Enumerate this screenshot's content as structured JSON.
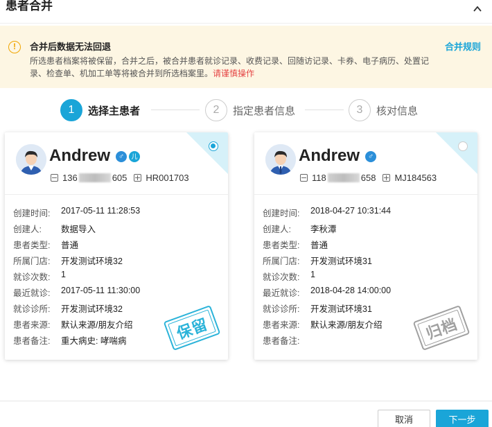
{
  "header": {
    "title": "患者合并"
  },
  "warning": {
    "title": "合并后数据无法回退",
    "text": "所选患者档案将被保留，合并之后，被合并患者就诊记录、收费记录、回随访记录、卡券、电子病历、处置记录、检查单、机加工单等将被合并到所选档案里。",
    "caution": "请谨慎操作",
    "rules_link": "合并规则"
  },
  "steps": [
    {
      "num": "1",
      "label": "选择主患者"
    },
    {
      "num": "2",
      "label": "指定患者信息"
    },
    {
      "num": "3",
      "label": "核对信息"
    }
  ],
  "cards": [
    {
      "name": "Andrew",
      "gender_symbol": "♂",
      "kid_symbol": "儿",
      "phone_prefix": "136",
      "phone_suffix": "605",
      "record_no": "HR001703",
      "selected": true,
      "stamp": "保留",
      "fields": [
        {
          "k": "创建时间:",
          "v": "2017-05-11 11:28:53"
        },
        {
          "k": "创建人:",
          "v": "数据导入"
        },
        {
          "k": "患者类型:",
          "v": "普通"
        },
        {
          "k": "所属门店:",
          "v": "开发测试环境32"
        },
        {
          "k": "就诊次数:",
          "v": "1"
        },
        {
          "k": "最近就诊:",
          "v": "2017-05-11 11:30:00"
        },
        {
          "k": "就诊诊所:",
          "v": "开发测试环境32"
        },
        {
          "k": "患者来源:",
          "v": "默认来源/朋友介绍"
        },
        {
          "k": "患者备注:",
          "v": "重大病史: 哮喘病"
        }
      ]
    },
    {
      "name": "Andrew",
      "gender_symbol": "♂",
      "phone_prefix": "118",
      "phone_suffix": "658",
      "record_no": "MJ184563",
      "selected": false,
      "stamp": "归档",
      "fields": [
        {
          "k": "创建时间:",
          "v": "2018-04-27 10:31:44"
        },
        {
          "k": "创建人:",
          "v": "李秋潭"
        },
        {
          "k": "患者类型:",
          "v": "普通"
        },
        {
          "k": "所属门店:",
          "v": "开发测试环境31"
        },
        {
          "k": "就诊次数:",
          "v": "1"
        },
        {
          "k": "最近就诊:",
          "v": "2018-04-28 14:00:00"
        },
        {
          "k": "就诊诊所:",
          "v": "开发测试环境31"
        },
        {
          "k": "患者来源:",
          "v": "默认来源/朋友介绍"
        },
        {
          "k": "患者备注:",
          "v": ""
        }
      ]
    }
  ],
  "footer": {
    "cancel": "取消",
    "next": "下一步"
  },
  "colors": {
    "accent": "#1aa5d8",
    "warning_bg": "#fdf6e3",
    "warning_icon": "#f0a500",
    "caution_red": "#e54545",
    "archive_gray": "#a0a0a0"
  }
}
